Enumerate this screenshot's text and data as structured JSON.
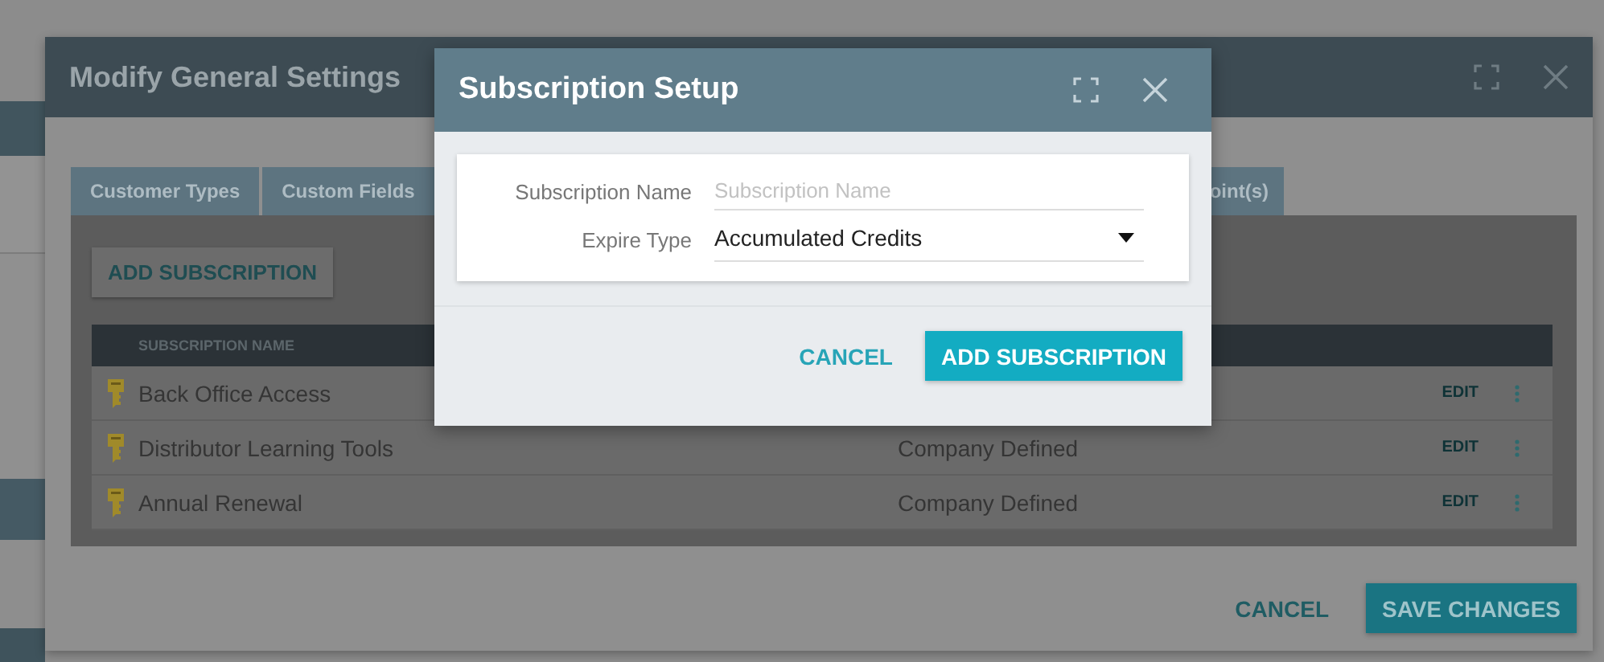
{
  "main_dialog": {
    "title": "Modify General Settings",
    "tabs": [
      {
        "label": "Customer Types",
        "selected": false
      },
      {
        "label": "Custom Fields",
        "selected": false
      },
      {
        "label": "oint(s)",
        "selected": false
      }
    ],
    "add_button": "ADD SUBSCRIPTION",
    "table": {
      "columns": [
        "SUBSCRIPTION NAME"
      ],
      "rows": [
        {
          "name": "Back Office Access",
          "edit": "EDIT"
        },
        {
          "name": "Distributor Learning Tools",
          "column_2": "Company Defined",
          "edit": "EDIT"
        },
        {
          "name": "Annual Renewal",
          "column_2": "Company Defined",
          "edit": "EDIT"
        }
      ]
    },
    "buttons": [
      {
        "label": "CANCEL",
        "kind": "text"
      },
      {
        "label": "SAVE CHANGES",
        "kind": "primary"
      }
    ]
  },
  "setup_dialog": {
    "title": "Subscription Setup",
    "fields": [
      {
        "label": "Subscription Name",
        "kind": "text",
        "placeholder": "Subscription Name"
      },
      {
        "label": "Expire Type",
        "kind": "select",
        "value": "Accumulated Credits"
      }
    ],
    "buttons": [
      {
        "label": "CANCEL",
        "kind": "text"
      },
      {
        "label": "ADD SUBSCRIPTION",
        "kind": "primary"
      }
    ]
  }
}
